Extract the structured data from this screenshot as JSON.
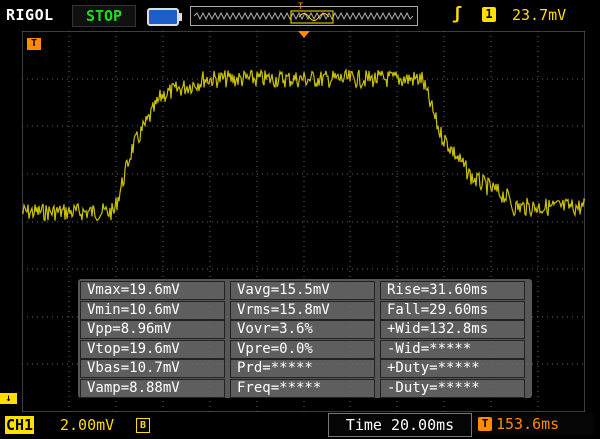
{
  "header": {
    "brand": "RIGOL",
    "run_state": "STOP",
    "trigger_edge_icon": "rising-edge-icon",
    "trigger_channel": "1",
    "trigger_level": "23.7mV"
  },
  "markers": {
    "channel": "↓",
    "trigger_position": "T"
  },
  "measurements": [
    [
      "Vmax=19.6mV",
      "Vavg=15.5mV",
      "Rise=31.60ms"
    ],
    [
      "Vmin=10.6mV",
      "Vrms=15.8mV",
      "Fall=29.60ms"
    ],
    [
      "Vpp=8.96mV",
      "Vovr=3.6%",
      "+Wid=132.8ms"
    ],
    [
      "Vtop=19.6mV",
      "Vpre=0.0%",
      "-Wid=*****"
    ],
    [
      "Vbas=10.7mV",
      "Prd=*****",
      "+Duty=*****"
    ],
    [
      "Vamp=8.88mV",
      "Freq=*****",
      "-Duty=*****"
    ]
  ],
  "footer": {
    "channel_label": "CH1",
    "channel_scale": "2.00mV",
    "bandwidth_icon": "B",
    "timebase": "Time 20.00ms",
    "trigger_offset_icon": "T",
    "trigger_offset": "153.6ms"
  },
  "colors": {
    "trace": "#c8c000",
    "accent_yellow": "#ffde00",
    "accent_orange": "#ff8c00",
    "run_green": "#19e019"
  }
}
